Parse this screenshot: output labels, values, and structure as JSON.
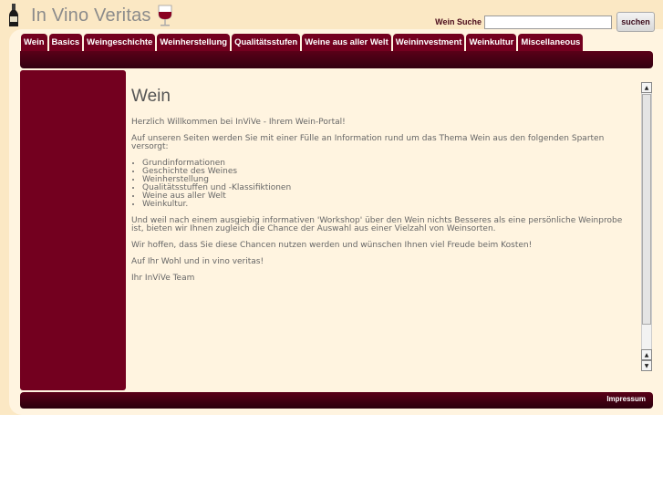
{
  "header": {
    "site_title": "In Vino Veritas",
    "search": {
      "label": "Wein Suche",
      "value": "",
      "placeholder": "",
      "button_label": "suchen"
    }
  },
  "nav": {
    "tabs": [
      {
        "label": "Wein"
      },
      {
        "label": "Basics"
      },
      {
        "label": "Weingeschichte"
      },
      {
        "label": "Weinherstellung"
      },
      {
        "label": "Qualitätsstufen"
      },
      {
        "label": "Weine aus aller Welt"
      },
      {
        "label": "Weininvestment"
      },
      {
        "label": "Weinkultur"
      },
      {
        "label": "Miscellaneous"
      }
    ]
  },
  "main": {
    "heading": "Wein",
    "intro": "Herzlich Willkommen bei InViVe - Ihrem Wein-Portal!",
    "paragraph1": "Auf unseren Seiten werden Sie mit einer Fülle an Information rund um das Thema Wein aus den folgenden Sparten versorgt:",
    "list": [
      "Grundinformationen",
      "Geschichte des Weines",
      "Weinherstellung",
      "Qualitätsstuffen und -Klassifiktionen",
      "Weine aus aller Welt",
      "Weinkultur."
    ],
    "paragraph2": "Und weil nach einem ausgiebig informativen 'Workshop' über den Wein nichts Besseres als eine persönliche Weinprobe ist, bieten wir Ihnen zugleich die Chance der Auswahl aus einer Vielzahl von Weinsorten.",
    "paragraph3": "Wir hoffen, dass Sie diese Chancen nutzen werden und wünschen Ihnen viel Freude beim Kosten!",
    "paragraph4": "Auf Ihr Wohl und in vino veritas!",
    "signature": "Ihr InViVe Team"
  },
  "footer": {
    "link_label": "Impressum"
  },
  "colors": {
    "accent": "#73001f",
    "bar_dark": "#320010",
    "page_bg": "#fbe8c4",
    "panel_bg": "#fff4e0"
  },
  "icons": {
    "logo_left": "wine-bottle-icon",
    "logo_right": "wine-glass-icon"
  }
}
